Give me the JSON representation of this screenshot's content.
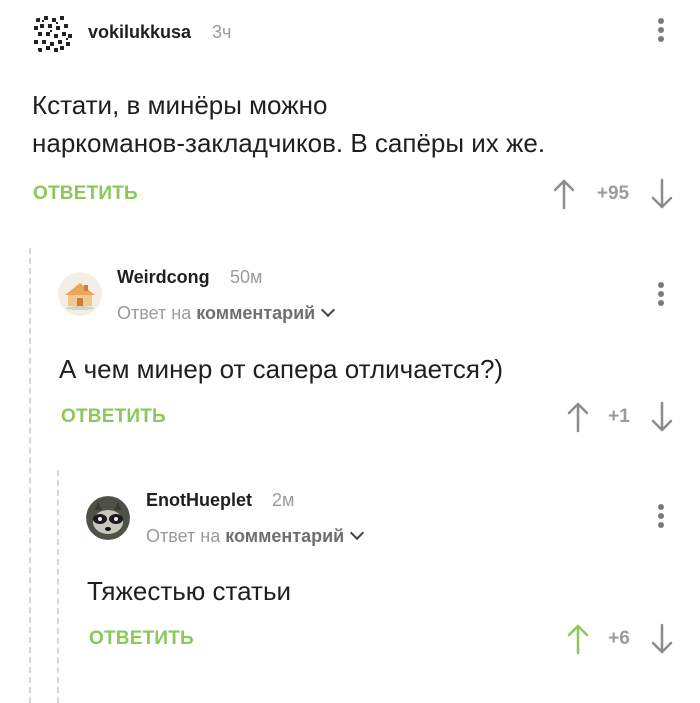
{
  "comments": [
    {
      "username": "vokilukkusa",
      "time": "3ч",
      "text_lines": [
        "Кстати, в минёры можно",
        "наркоманов-закладчиков. В сапёры их же."
      ],
      "reply_label": "ОТВЕТИТЬ",
      "score": "+95",
      "upvoted": false
    },
    {
      "username": "Weirdcong",
      "time": "50м",
      "reply_prefix": "Ответ на",
      "reply_link": "комментарий",
      "text_lines": [
        "А чем минер от сапера отличается?)"
      ],
      "reply_label": "ОТВЕТИТЬ",
      "score": "+1",
      "upvoted": false
    },
    {
      "username": "EnotHueplet",
      "time": "2м",
      "reply_prefix": "Ответ на",
      "reply_link": "комментарий",
      "text_lines": [
        "Тяжестью статьи"
      ],
      "reply_label": "ОТВЕТИТЬ",
      "score": "+6",
      "upvoted": true
    }
  ],
  "colors": {
    "accent_green": "#8ac858",
    "muted_gray": "#9b9b9b",
    "text": "#1f1f1f"
  },
  "icons": {
    "upvote": "arrow-up-icon",
    "downvote": "arrow-down-icon",
    "more": "more-vertical-icon",
    "expand": "chevron-down-icon"
  }
}
